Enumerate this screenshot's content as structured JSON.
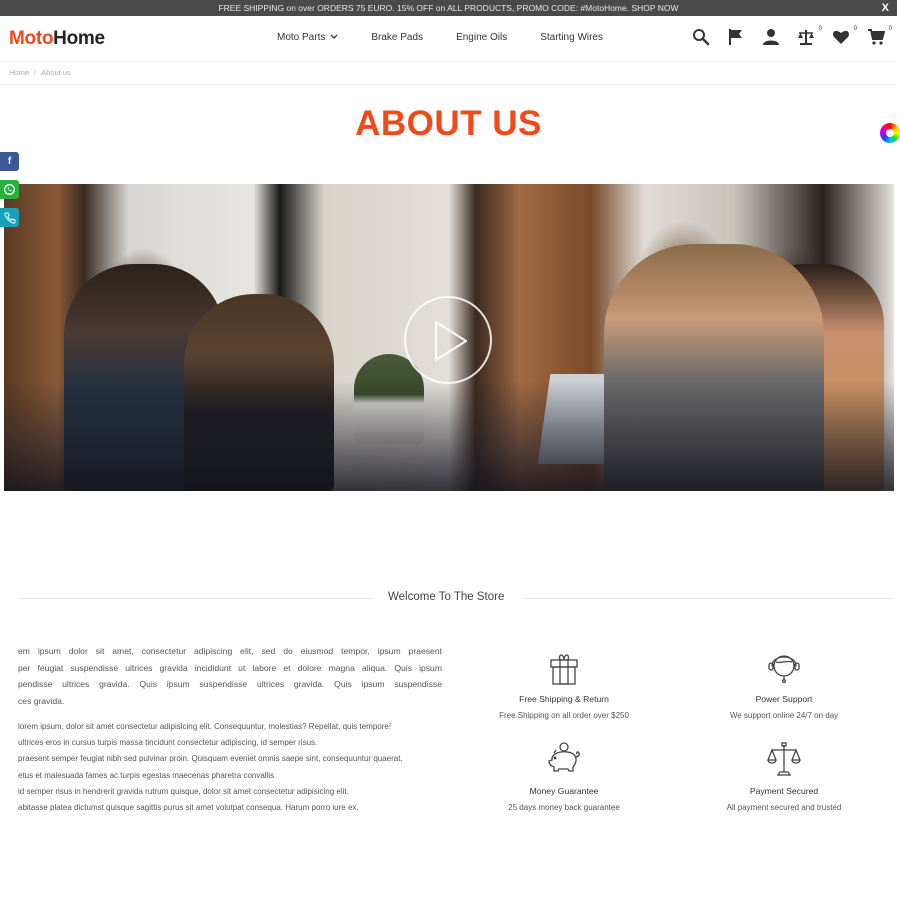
{
  "announcement": {
    "text": "FREE SHIPPING on over ORDERS 75 EURO. 15% OFF on ALL PRODUCTS, PROMO CODE: #MotoHome. SHOP NOW",
    "close_label": "X"
  },
  "header": {
    "logo": {
      "part1": "Moto",
      "part2": "Home",
      "brand_color": "#f04a1a"
    },
    "nav": [
      {
        "label": "Moto Parts",
        "has_dropdown": true
      },
      {
        "label": "Brake Pads"
      },
      {
        "label": "Engine Oils"
      },
      {
        "label": "Starting Wires"
      }
    ],
    "icons": [
      {
        "name": "search-icon"
      },
      {
        "name": "flag-icon"
      },
      {
        "name": "user-icon"
      },
      {
        "name": "compare-scale-icon",
        "count": "0"
      },
      {
        "name": "heart-icon",
        "count": "0"
      },
      {
        "name": "cart-icon",
        "count": "0"
      }
    ]
  },
  "breadcrumb": {
    "items": [
      "Home",
      "About us"
    ]
  },
  "page": {
    "title": "ABOUT US",
    "title_color": "#f04a1a"
  },
  "social": [
    {
      "name": "facebook",
      "glyph": "f",
      "color": "#3b5998"
    },
    {
      "name": "whatsapp",
      "color": "#25b03f"
    },
    {
      "name": "phone",
      "color": "#17a2b8"
    }
  ],
  "hero": {
    "media": "team-working-photo",
    "play_button": "play-video"
  },
  "welcome": {
    "heading": "Welcome To The Store",
    "paragraph1": [
      "em ipsum dolor sit amet, consectetur adipiscing elit, sed do eiusmod tempor, ipsum praesent",
      "per feugiat suspendisse ultrices gravida incididunt ut labore et dolore magna aliqua. Quis ipsum",
      "pendisse ultrices gravida. Quis ipsum suspendisse ultrices gravida. Quis ipsum suspendisse",
      "ces gravida."
    ],
    "paragraph2": [
      "lorem ipsum, dolor sit amet consectetur adipisicing elit. Consequuntur, molestias? Repellat, quis tempore!",
      "ultrices eros in cursus turpis massa tincidunt consectetur adipiscing, id semper risus.",
      "praesent semper feugiat nibh sed pulvinar proin. Quisquam eveniet omnis saepe sint, consequuntur quaerat.",
      "etus et malesuada fames ac turpis egestas maecenas pharetra convallis",
      "id semper risus in hendrerit gravida rutrum quisque, dolor sit amet consectetur adipisicing elit.",
      "abitasse platea dictumst quisque sagittis purus sit amet volutpat consequa. Harum porro iure ex."
    ]
  },
  "features": [
    {
      "icon": "gift-icon",
      "title": "Free Shipping & Return",
      "desc": "Free Shipping on all order over $250"
    },
    {
      "icon": "support-headset-icon",
      "title": "Power Support",
      "desc": "We support online 24/7 on day"
    },
    {
      "icon": "piggy-bank-icon",
      "title": "Money Guarantee",
      "desc": "25 days money back guarantee"
    },
    {
      "icon": "scale-icon",
      "title": "Payment Secured",
      "desc": "All payment secured and trusted"
    }
  ]
}
